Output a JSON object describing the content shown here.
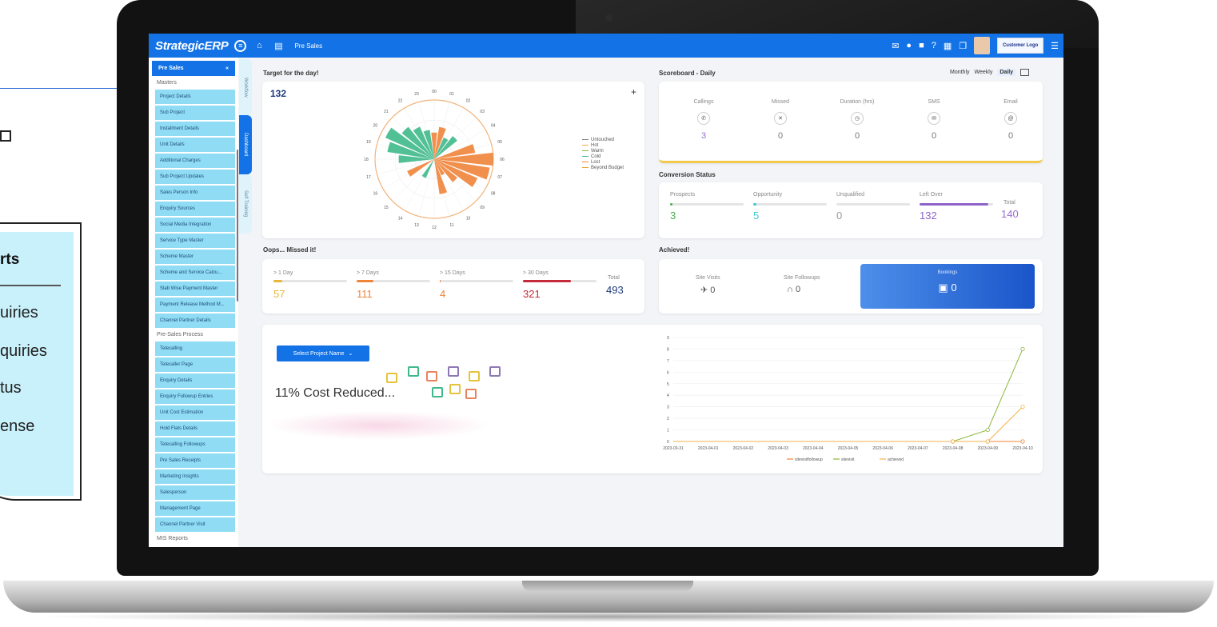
{
  "background": {
    "card_title": "rts",
    "card_items": [
      "uiries",
      "quiries",
      "tus",
      "ense"
    ]
  },
  "topbar": {
    "brand": "StrategicERP",
    "breadcrumb": "Pre Sales",
    "customer_logo": "Customer Logo"
  },
  "sidebar": {
    "header": "Pre Sales",
    "header_icon": "«",
    "group_masters": "Masters",
    "masters": [
      "Project Details",
      "Sub Project",
      "Installment Details",
      "Unit Details",
      "Additional Charges",
      "Sub Project Updates",
      "Sales Person Info",
      "Enquiry Sources",
      "Social Media Integration",
      "Service Type Master",
      "Scheme Master",
      "Scheme and Service Calcu...",
      "Slab Wise Payment Master",
      "Payment Release Method M...",
      "Channel Partner Details"
    ],
    "group_process": "Pre-Sales Process",
    "process": [
      "Telecalling",
      "Telecaller Page",
      "Enquiry Details",
      "Enquiry Followup Entries",
      "Unit Cost Estimation",
      "Hold Flats Details",
      "Telecalling Followups",
      "Pre Sales Receipts",
      "Marketing Insights",
      "Salesperson",
      "Management Page",
      "Channel Partner Visit"
    ],
    "group_reports": "MIS Reports"
  },
  "vtabs": [
    "Workflow",
    "Dashboard",
    "Self Training"
  ],
  "target": {
    "title": "Target for the day!",
    "value": "132",
    "plus": "+",
    "hour_labels": [
      "00",
      "01",
      "02",
      "03",
      "04",
      "05",
      "06",
      "07",
      "08",
      "09",
      "10",
      "11",
      "12",
      "13",
      "14",
      "15",
      "16",
      "17",
      "18",
      "19",
      "20",
      "21",
      "22",
      "23"
    ],
    "legend": [
      "Untouched",
      "Hot",
      "Warm",
      "Cold",
      "Lost",
      "Beyond Budget"
    ],
    "colors": {
      "green": "#3fb98a",
      "orange": "#f0843a",
      "ring": "#f2b27a"
    }
  },
  "scoreboard": {
    "title": "Scoreboard - Daily",
    "tabs": [
      "Monthly",
      "Weekly",
      "Daily"
    ],
    "items": [
      {
        "label": "Callings",
        "value": "3",
        "icon": "phone-icon"
      },
      {
        "label": "Missed",
        "value": "0",
        "icon": "missed-call-icon"
      },
      {
        "label": "Duration (hrs)",
        "value": "0",
        "icon": "timer-icon"
      },
      {
        "label": "SMS",
        "value": "0",
        "icon": "sms-icon"
      },
      {
        "label": "Email",
        "value": "0",
        "icon": "at-icon"
      }
    ]
  },
  "conversion": {
    "title": "Conversion Status",
    "items": [
      {
        "label": "Prospects",
        "value": "3",
        "color": "#4caf50",
        "fill": 0.02
      },
      {
        "label": "Opportunity",
        "value": "5",
        "color": "#3fc6d6",
        "fill": 0.04
      },
      {
        "label": "Unqualified",
        "value": "0",
        "color": "#999999",
        "fill": 0
      },
      {
        "label": "Left Over",
        "value": "132",
        "color": "#8e63c9",
        "fill": 0.94
      }
    ],
    "total_label": "Total",
    "total_value": "140"
  },
  "missed": {
    "title": "Oops... Missed it!",
    "items": [
      {
        "label": "> 1 Day",
        "value": "57",
        "color": "#e6b73a",
        "fill": 0.12
      },
      {
        "label": "> 7 Days",
        "value": "111",
        "color": "#f0843a",
        "fill": 0.23
      },
      {
        "label": "> 15 Days",
        "value": "4",
        "color": "#f0843a",
        "fill": 0.01
      },
      {
        "label": "> 30 Days",
        "value": "321",
        "color": "#c42a3a",
        "fill": 0.65
      }
    ],
    "total_label": "Total",
    "total_value": "493"
  },
  "achieved": {
    "title": "Achieved!",
    "items": [
      {
        "label": "Site Visits",
        "value": "0"
      },
      {
        "label": "Site Followups",
        "value": "0"
      },
      {
        "label": "Bookings",
        "value": "0"
      }
    ]
  },
  "project": {
    "select_label": "Select Project Name",
    "headline": "11% Cost Reduced..."
  },
  "chart_data": {
    "type": "line",
    "x": [
      "2023-03-31",
      "2023-04-01",
      "2023-04-02",
      "2023-04-03",
      "2023-04-04",
      "2023-04-05",
      "2023-04-06",
      "2023-04-07",
      "2023-04-08",
      "2023-04-09",
      "2023-04-10"
    ],
    "ylim": [
      0,
      9
    ],
    "y_ticks": [
      "0",
      "1",
      "2",
      "3",
      "4",
      "5",
      "6",
      "7",
      "8",
      "9"
    ],
    "series": [
      {
        "name": "sitevisitfollowup",
        "color": "#f0843a",
        "values": [
          0,
          0,
          0,
          0,
          0,
          0,
          0,
          0,
          0,
          0,
          0
        ]
      },
      {
        "name": "sitevisit",
        "color": "#8bb83a",
        "values": [
          0,
          0,
          0,
          0,
          0,
          0,
          0,
          0,
          0,
          1,
          8
        ]
      },
      {
        "name": "achieved",
        "color": "#f2b04a",
        "values": [
          0,
          0,
          0,
          0,
          0,
          0,
          0,
          0,
          0,
          0,
          3
        ]
      }
    ]
  }
}
